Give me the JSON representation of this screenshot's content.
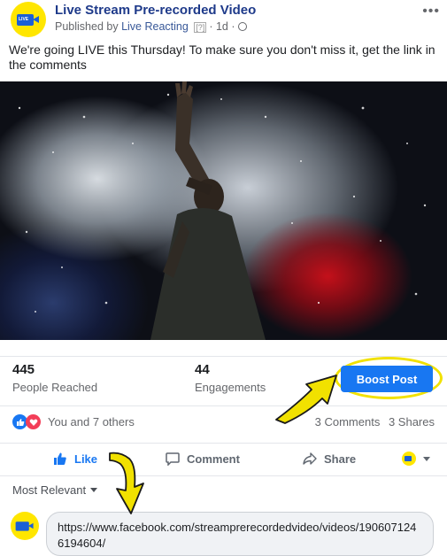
{
  "header": {
    "page_name": "Live Stream Pre-recorded Video",
    "published_prefix": "Published by",
    "publisher": "Live Reacting",
    "help_badge": "[?]",
    "time": "· 1d ·",
    "more_label": "•••",
    "logo_text": "LIVE"
  },
  "post_text": "We're going LIVE this Thursday! To make sure you don't miss it, get the link in the comments",
  "stats": {
    "reached_value": "445",
    "reached_label": "People Reached",
    "engagements_value": "44",
    "engagements_label": "Engagements",
    "boost_label": "Boost Post"
  },
  "reactions": {
    "summary": "You and 7 others",
    "comments": "3 Comments",
    "shares": "3 Shares"
  },
  "actions": {
    "like": "Like",
    "comment": "Comment",
    "share": "Share"
  },
  "sort_label": "Most Relevant",
  "comment_input": {
    "value": "https://www.facebook.com/streamprerecordedvideo/videos/1906071246194604/"
  },
  "colors": {
    "accent": "#1877f2",
    "highlight": "#f1e100",
    "logo_bg": "#ffe600"
  },
  "icons": [
    "camera-logo-icon",
    "globe-icon",
    "like-icon",
    "love-icon",
    "thumbs-up-icon",
    "comment-icon",
    "share-icon",
    "chevron-down-icon",
    "arrow-annotation-icon"
  ]
}
